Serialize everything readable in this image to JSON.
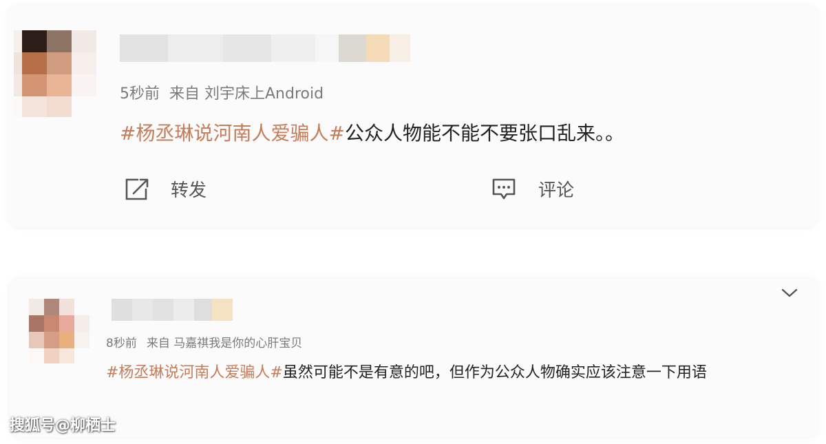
{
  "posts": [
    {
      "time": "5秒前",
      "source": "来自 刘宇床上Android",
      "hashtag": "#杨丞琳说河南人爱骗人#",
      "text": "公众人物能不能不要张口乱来。。",
      "actions": {
        "repost": "转发",
        "comment": "评论"
      }
    },
    {
      "time": "8秒前",
      "source": "来自 马嘉祺我是你的心肝宝贝",
      "hashtag": "#杨丞琳说河南人爱骗人#",
      "text": "虽然可能不是有意的吧，但作为公众人物确实应该注意一下用语"
    }
  ],
  "watermark": "搜狐号@柳栖士",
  "icons": {
    "avatar": "pixelated-avatar",
    "username": "blurred-username",
    "repost": "repost-icon",
    "comment": "comment-icon",
    "expand": "chevron-down-icon"
  },
  "colors": {
    "hashtag": "#c47d5a",
    "meta": "#7a7a7a",
    "text": "#222222"
  }
}
